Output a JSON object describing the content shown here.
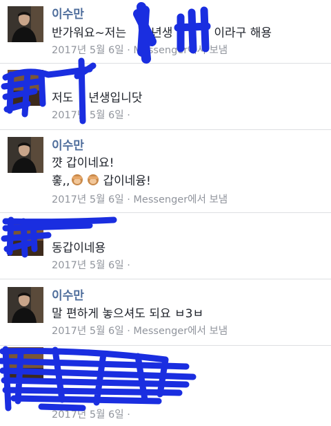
{
  "messages": [
    {
      "sender": "이수만",
      "lines": [
        "반가워요~저는",
        "년생",
        "이라구 해용"
      ],
      "meta": "2017년 5월 6일 · Messenger에서 보냄"
    },
    {
      "lines": [
        "저도",
        "년생입니닷"
      ],
      "meta": "2017년 5월 6일 ·"
    },
    {
      "sender": "이수만",
      "lines": [
        "꺗 갑이네요!",
        "홓,,",
        "갑이네융!"
      ],
      "meta": "2017년 5월 6일 · Messenger에서 보냄"
    },
    {
      "lines": [
        "동갑이네용"
      ],
      "meta": "2017년 5월 6일 ·"
    },
    {
      "sender": "이수만",
      "lines": [
        "말 편하게 놓으셔도 되요 ㅂ3ㅂ"
      ],
      "meta": "2017년 5월 6일 · Messenger에서 보냄"
    },
    {
      "meta": "2017년 5월 6일 ·"
    }
  ],
  "colors": {
    "sender_name": "#4f6e9c",
    "body_text": "#1d2129",
    "meta_text": "#90949c",
    "redaction": "#1a2ee0"
  }
}
